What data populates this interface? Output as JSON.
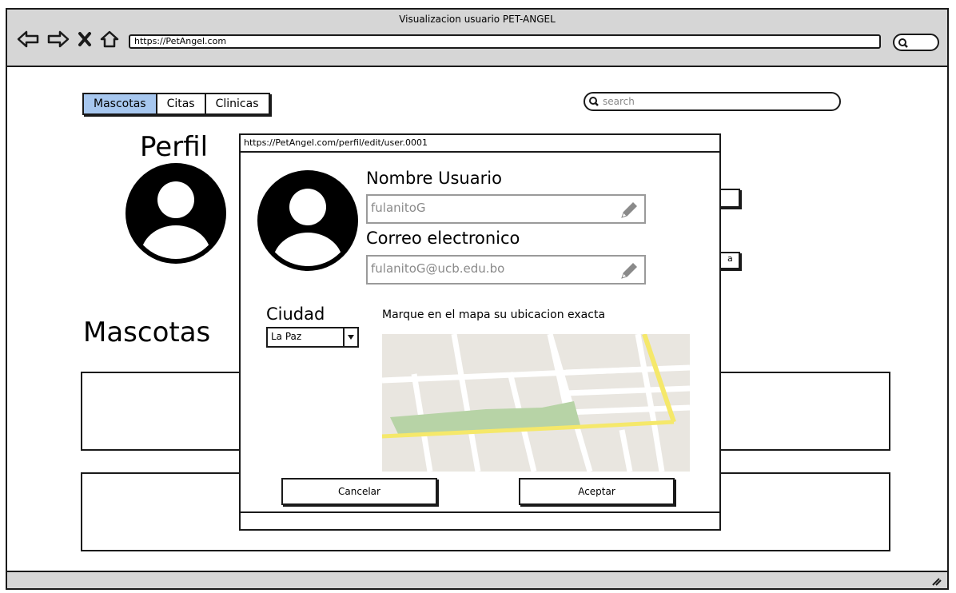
{
  "window": {
    "title": "Visualizacion usuario PET-ANGEL",
    "url": "https://PetAngel.com"
  },
  "nav_icons": [
    "back-arrow-icon",
    "forward-arrow-icon",
    "close-x-icon",
    "home-icon"
  ],
  "tabs": [
    {
      "label": "Mascotas",
      "active": true
    },
    {
      "label": "Citas",
      "active": false
    },
    {
      "label": "Clinicas",
      "active": false
    }
  ],
  "search": {
    "placeholder": "search"
  },
  "page": {
    "perfil_title": "Perfil",
    "mascotas_title": "Mascotas"
  },
  "background_stub": {
    "text": "a"
  },
  "modal": {
    "url": "https://PetAngel.com/perfil/edit/user.0001",
    "username_label": "Nombre Usuario",
    "username_value": "fulanitoG",
    "email_label": "Correo electronico",
    "email_value": "fulanitoG@ucb.edu.bo",
    "city_label": "Ciudad",
    "city_value": "La Paz",
    "map_label": "Marque en el mapa su ubicacion exacta",
    "cancel_label": "Cancelar",
    "accept_label": "Aceptar"
  },
  "colors": {
    "active_tab": "#a7c7ef",
    "chrome": "#d6d6d6",
    "map_road_major": "#f5e86a",
    "map_park": "#b7d3a6",
    "map_land": "#e9e6e0"
  }
}
